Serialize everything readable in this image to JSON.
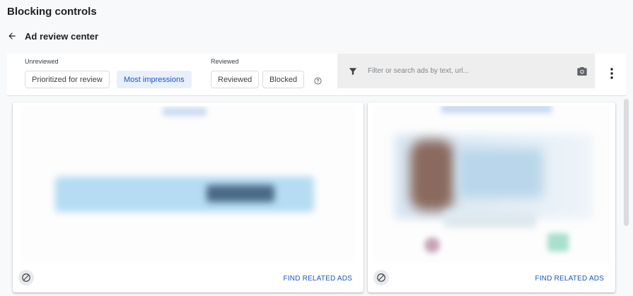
{
  "page": {
    "title": "Blocking controls",
    "breadcrumb": "Ad review center"
  },
  "filters": {
    "unreviewed_label": "Unreviewed",
    "unreviewed_chips": [
      {
        "label": "Prioritized for review",
        "selected": false
      },
      {
        "label": "Most impressions",
        "selected": true
      }
    ],
    "reviewed_label": "Reviewed",
    "reviewed_chips": [
      {
        "label": "Reviewed",
        "selected": false
      },
      {
        "label": "Blocked",
        "selected": false
      }
    ],
    "icons": {
      "help": "help-circle-icon",
      "filter": "filter-icon",
      "camera": "camera-icon",
      "more": "more-vert-icon"
    }
  },
  "search": {
    "placeholder": "Filter or search ads by text, url..."
  },
  "cards": [
    {
      "action_label": "FIND RELATED ADS",
      "block_icon": "block-icon"
    },
    {
      "action_label": "FIND RELATED ADS",
      "block_icon": "block-icon"
    }
  ],
  "colors": {
    "accent": "#1a56c4",
    "chip_selected_bg": "#e8f0fe",
    "page_bg": "#f8f9fa",
    "search_bg": "#eeeeee"
  }
}
